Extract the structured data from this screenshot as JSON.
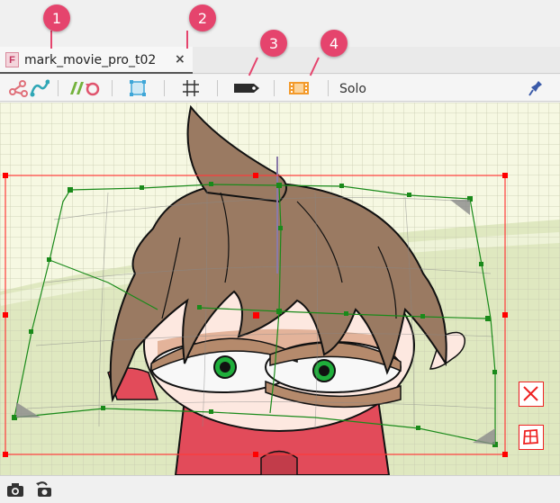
{
  "tab": {
    "icon_letter": "F",
    "title": "mark_movie_pro_t02",
    "close": "×"
  },
  "callouts": [
    "1",
    "2",
    "3",
    "4"
  ],
  "toolbar": {
    "solo_label": "Solo",
    "icons": [
      "deformer-tools-icon",
      "rotation-tools-icon",
      "transform-frame-icon",
      "grid-icon",
      "tag-icon",
      "film-icon",
      "pin-icon"
    ]
  },
  "canvas": {
    "side_buttons": [
      "close-mesh-icon",
      "mesh-grid-icon"
    ]
  },
  "bottombar": {
    "icons": [
      "camera-icon",
      "camera-reset-icon"
    ]
  },
  "colors": {
    "callout": "#e5446d",
    "selection": "#ff0000",
    "deformer": "#1a8a1a",
    "hair": "#9a7a62",
    "background_green": "#dfe8c0"
  }
}
